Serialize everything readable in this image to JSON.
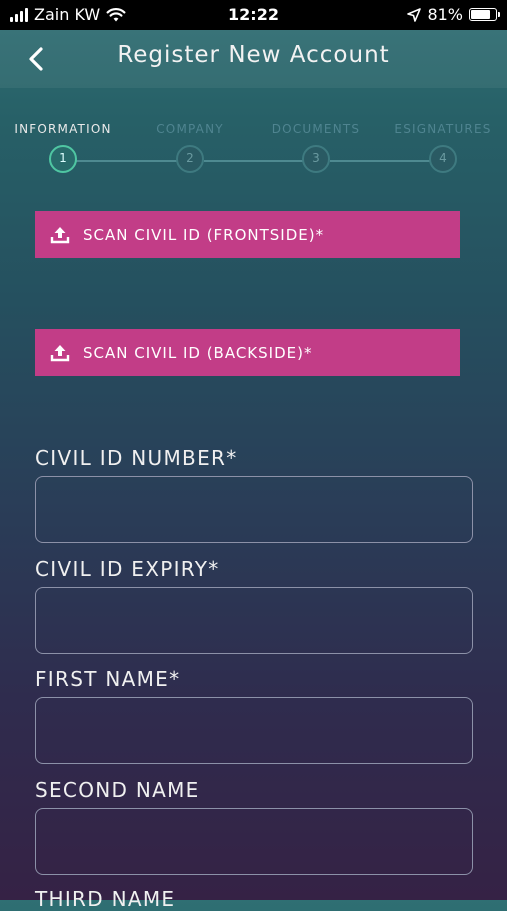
{
  "status_bar": {
    "carrier": "Zain KW",
    "time": "12:22",
    "battery_percent": "81%",
    "battery_level": 0.81,
    "signal_bars": 4,
    "icons": [
      "signal-icon",
      "wifi-icon",
      "location-arrow-icon",
      "battery-icon"
    ]
  },
  "header": {
    "title": "Register New Account",
    "back_icon": "chevron-left-icon"
  },
  "stepper": {
    "active_index": 0,
    "steps": [
      {
        "label": "INFORMATION",
        "number": "1"
      },
      {
        "label": "COMPANY",
        "number": "2"
      },
      {
        "label": "DOCUMENTS",
        "number": "3"
      },
      {
        "label": "ESIGNATURES",
        "number": "4"
      }
    ]
  },
  "scan_buttons": {
    "front_label": "SCAN CIVIL ID (FRONTSIDE)*",
    "back_label": "SCAN CIVIL ID (BACKSIDE)*",
    "icon": "upload-icon"
  },
  "form": {
    "civil_id_number": {
      "label": "CIVIL ID NUMBER*",
      "value": ""
    },
    "civil_id_expiry": {
      "label": "CIVIL ID EXPIRY*",
      "value": ""
    },
    "first_name": {
      "label": "FIRST NAME*",
      "value": ""
    },
    "second_name": {
      "label": "SECOND NAME",
      "value": ""
    },
    "third_name": {
      "label": "THIRD NAME"
    }
  },
  "colors": {
    "accent_pink": "#c23d87",
    "active_step": "#4fc6a2",
    "inactive_step": "#4f8490"
  }
}
